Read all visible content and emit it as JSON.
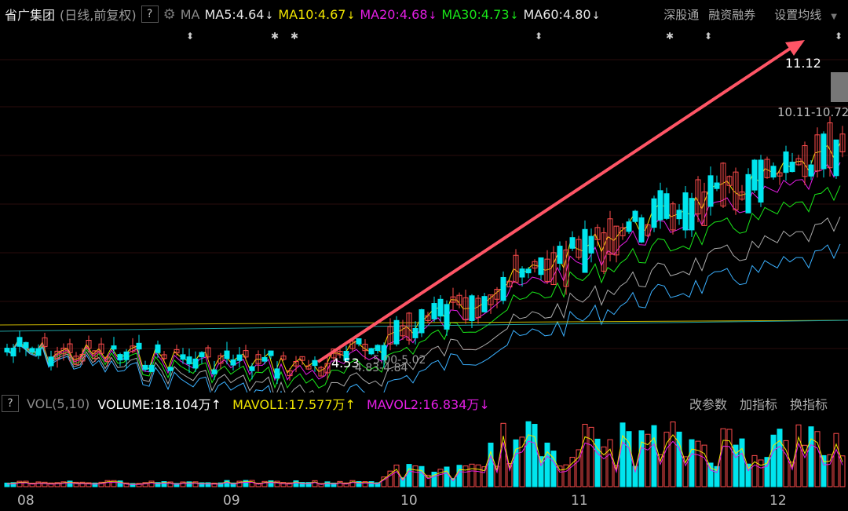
{
  "header": {
    "stock_name": "省广集团",
    "period": "(日线,前复权)",
    "help": "?",
    "ma_tag": "MA",
    "ma5": "MA5:4.64",
    "ma10": "MA10:4.67",
    "ma20": "MA20:4.68",
    "ma30": "MA30:4.73",
    "ma60": "MA60:4.80",
    "down_arrow": "↓",
    "links": [
      "深股通",
      "融资融券",
      "设置均线"
    ]
  },
  "chart_labels": {
    "high": "11.12",
    "range_high": "10.11-10.72",
    "low": "4.53",
    "range_mid1": "5.00-5.02",
    "range_mid2": "4.83-4.84"
  },
  "volume_bar": {
    "help": "?",
    "label": "VOL(5,10)",
    "volume": "VOLUME:18.104万",
    "mavol1": "MAVOL1:17.577万",
    "mavol2": "MAVOL2:16.834万",
    "up_arrow": "↑",
    "down_arrow": "↓",
    "links": [
      "改参数",
      "加指标",
      "换指标"
    ]
  },
  "months": [
    "08",
    "09",
    "10",
    "11",
    "12"
  ],
  "colors": {
    "up": "#ff4c4c",
    "down": "#00e5ee",
    "ma10": "#f2e600",
    "ma20": "#e51ee5",
    "ma30": "#19e619",
    "ma60": "#aaaaaa",
    "arrow": "#ff5566"
  }
}
